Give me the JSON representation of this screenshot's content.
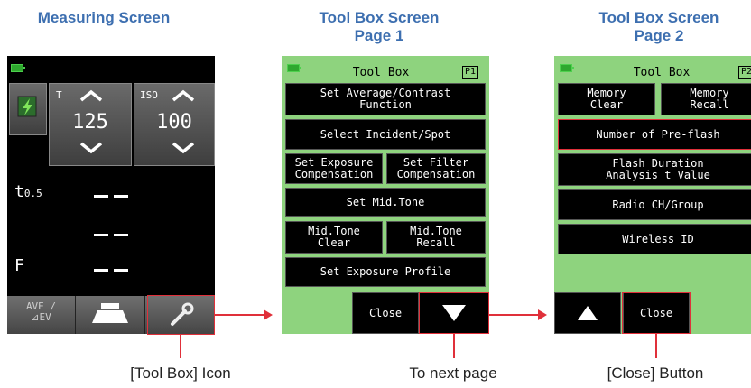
{
  "headings": {
    "measuring": "Measuring Screen",
    "toolbox_p1": "Tool Box Screen\nPage 1",
    "toolbox_p2": "Tool Box Screen\nPage 2"
  },
  "measuring": {
    "t_label": "T",
    "t_value": "125",
    "iso_label": "ISO",
    "iso_value": "100",
    "t05_label": "t",
    "t05_sub": "0.5",
    "f_label": "F",
    "ave_label": "AVE /\n⊿EV"
  },
  "toolbox_p1": {
    "title": "Tool Box",
    "page": "P1",
    "buttons": [
      "Set Average/Contrast\nFunction",
      "Select Incident/Spot",
      "Set Exposure\nCompensation",
      "Set Filter\nCompensation",
      "Set Mid.Tone",
      "Mid.Tone\nClear",
      "Mid.Tone\nRecall",
      "Set Exposure Profile"
    ],
    "close": "Close"
  },
  "toolbox_p2": {
    "title": "Tool Box",
    "page": "P2",
    "buttons": [
      "Memory\nClear",
      "Memory\nRecall",
      "Number of Pre-flash",
      "Flash Duration\nAnalysis t Value",
      "Radio CH/Group",
      "Wireless ID"
    ],
    "close": "Close"
  },
  "captions": {
    "toolbox_icon": "[Tool Box] Icon",
    "next_page": "To next page",
    "close_button": "[Close] Button"
  },
  "colors": {
    "heading": "#3d6fb0",
    "highlight": "#e0303a",
    "screen_green": "#8ed37e"
  },
  "icons": [
    "battery-icon",
    "flash-icon",
    "chevron-up-icon",
    "chevron-down-icon",
    "meter-head-icon",
    "wrench-icon",
    "triangle-down-icon",
    "triangle-up-icon"
  ]
}
